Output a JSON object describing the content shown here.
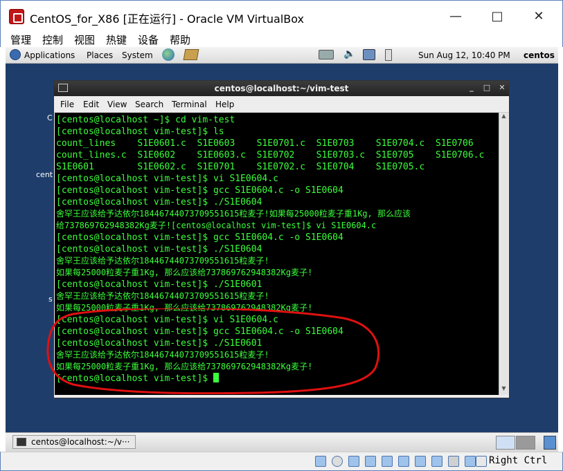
{
  "window": {
    "title": "CentOS_for_X86 [正在运行] - Oracle VM VirtualBox"
  },
  "vbox_menu": [
    "管理",
    "控制",
    "视图",
    "热键",
    "设备",
    "帮助"
  ],
  "gnome_panel": {
    "apps": "Applications",
    "places": "Places",
    "system": "System",
    "clock": "Sun Aug 12, 10:40 PM",
    "user": "centos"
  },
  "desktop_fragments": [
    "C",
    "cent",
    "s"
  ],
  "terminal": {
    "title": "centos@localhost:~/vim-test",
    "menu": [
      "File",
      "Edit",
      "View",
      "Search",
      "Terminal",
      "Help"
    ],
    "lines": [
      "[centos@localhost ~]$ cd vim-test",
      "[centos@localhost vim-test]$ ls",
      "count_lines    S1E0601.c  S1E0603    S1E0701.c  S1E0703    S1E0704.c  S1E0706",
      "count_lines.c  S1E0602    S1E0603.c  S1E0702    S1E0703.c  S1E0705    S1E0706.c",
      "S1E0601        S1E0602.c  S1E0701    S1E0702.c  S1E0704    S1E0705.c",
      "[centos@localhost vim-test]$ vi S1E0604.c",
      "[centos@localhost vim-test]$ gcc S1E0604.c -o S1E0604",
      "[centos@localhost vim-test]$ ./S1E0604",
      "舍罕王应该给予达依尔18446744073709551615粒麦子!如果每25000粒麦子重1Kg, 那么应该",
      "给737869762948382Kg麦子![centos@localhost vim-test]$ vi S1E0604.c",
      "[centos@localhost vim-test]$ gcc S1E0604.c -o S1E0604",
      "[centos@localhost vim-test]$ ./S1E0604",
      "舍罕王应该给予达依尔18446744073709551615粒麦子!",
      "如果每25000粒麦子重1Kg, 那么应该给737869762948382Kg麦子!",
      "[centos@localhost vim-test]$ ./S1E0601",
      "舍罕王应该给予达依尔18446744073709551615粒麦子!",
      "如果每25000粒麦子重1Kg, 那么应该给737869762948382Kg麦子!",
      "[centos@localhost vim-test]$ vi S1E0604.c",
      "[centos@localhost vim-test]$ gcc S1E0604.c -o S1E0604",
      "[centos@localhost vim-test]$ ./S1E0601",
      "舍罕王应该给予达依尔18446744073709551615粒麦子!",
      "如果每25000粒麦子重1Kg, 那么应该给737869762948382Kg麦子!",
      "[centos@localhost vim-test]$ "
    ]
  },
  "taskbar": {
    "item": "centos@localhost:~/v···"
  },
  "vbox_status": {
    "host_key": "Right Ctrl"
  },
  "colors": {
    "terminal_text": "#3cff3c",
    "annotation": "#e01010",
    "desktop": "#1e3d6b"
  }
}
